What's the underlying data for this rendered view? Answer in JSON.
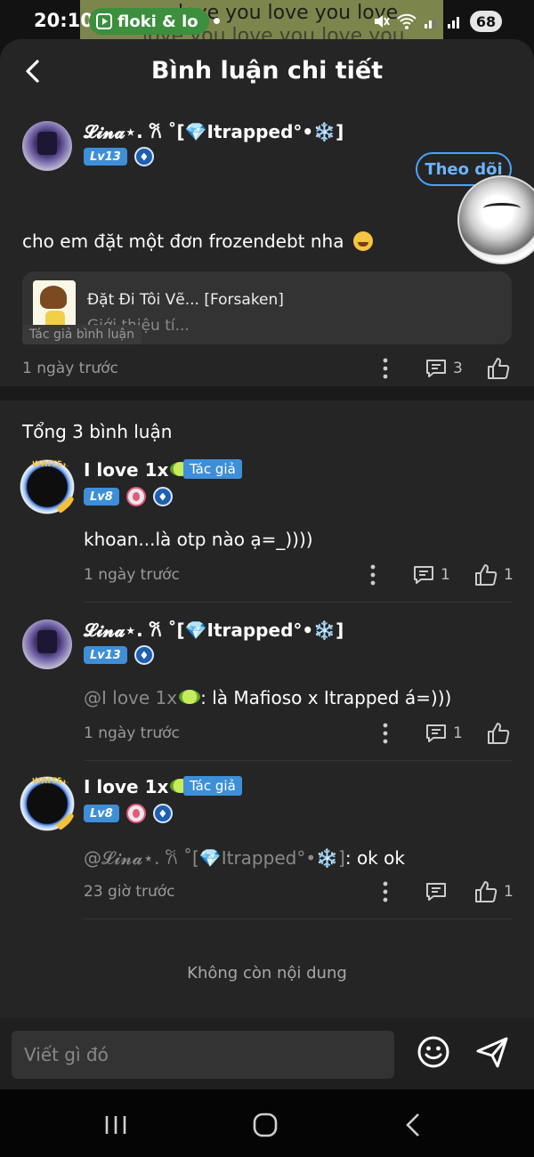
{
  "status_bar": {
    "time": "20:10",
    "notification_app": "floki & lo",
    "marquee_text": "love you love you love",
    "marquee_text_2": "love you love you love you",
    "battery": "68"
  },
  "header": {
    "title": "Bình luận chi tiết"
  },
  "post": {
    "username": "𝓛𝓲𝓷𝓪⋆. 𐙚 ˚[💎Itrapped°•❄️]",
    "level": "Lv13",
    "follow_label": "Theo dõi",
    "text": "cho em đặt một đơn frozendebt nha",
    "link_title": "Đặt Đi Tôi Vẽ... [Forsaken]",
    "link_subtitle": "Giới thiệu tí...",
    "time": "1 ngày trước",
    "reply_count": "3",
    "author_tag": "Tác giả bình luận"
  },
  "total_comments": "Tổng 3 bình luận",
  "comments": [
    {
      "username": "I love 1x",
      "author_badge": "Tác giả",
      "level": "Lv8",
      "text": "khoan...là otp nào ạ=_))))",
      "time": "1 ngày trước",
      "reply_count": "1",
      "like_count": "1"
    },
    {
      "username": "𝓛𝓲𝓷𝓪⋆. 𐙚 ˚[💎Itrapped°•❄️]",
      "level": "Lv13",
      "mention": "@I love 1x",
      "text": ": là Mafioso x Itrapped  á=)))",
      "time": "1 ngày trước",
      "reply_count": "1"
    },
    {
      "username": "I love 1x",
      "author_badge": "Tác giả",
      "level": "Lv8",
      "mention": "@𝓛𝓲𝓷𝓪⋆. 𐙚 ˚[💎Itrapped°•❄️]",
      "text": ": ok ok",
      "time": "23 giờ trước",
      "like_count": "1"
    }
  ],
  "end_text": "Không còn nội dung",
  "composer": {
    "placeholder": "Viết gì đó"
  },
  "colors": {
    "accent": "#3e8fd8",
    "follow": "#4aa3ff",
    "background": "#252525"
  },
  "icons": [
    "back-arrow-icon",
    "more-dots-icon",
    "comment-icon",
    "like-icon",
    "emoji-icon",
    "send-icon",
    "recents-icon",
    "home-icon",
    "nav-back-icon"
  ]
}
